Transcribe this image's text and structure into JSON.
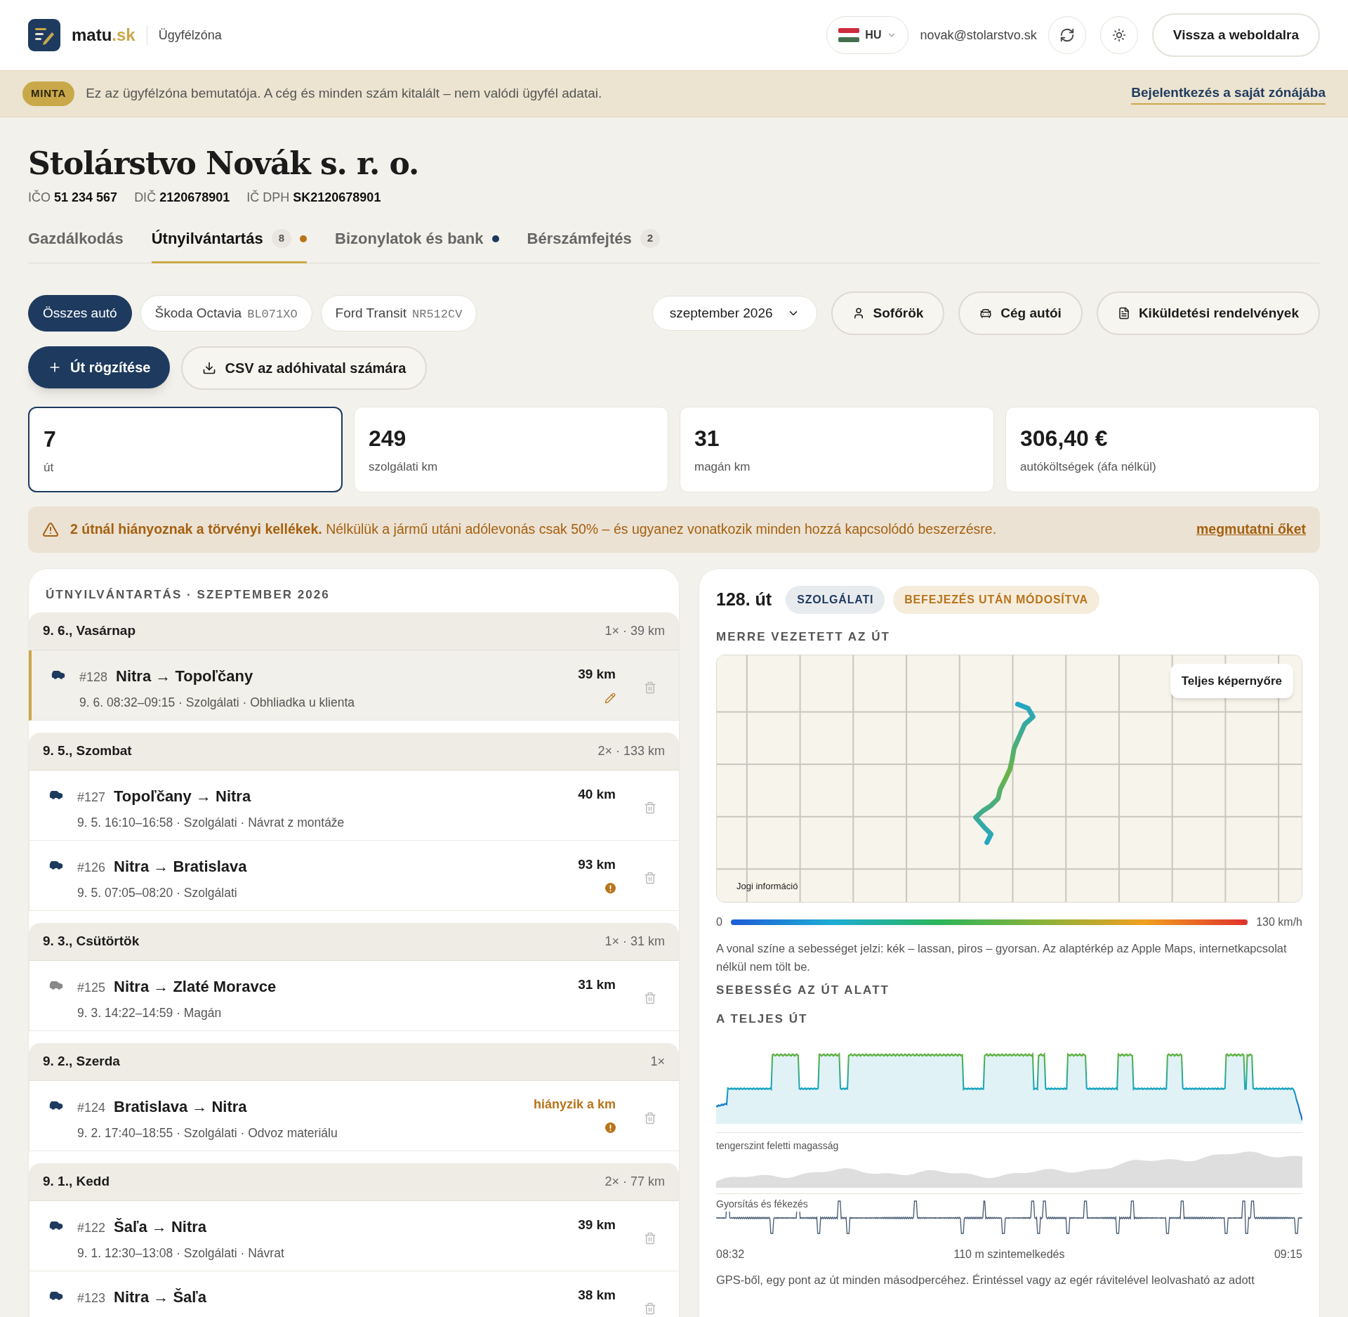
{
  "header": {
    "logo_text": "matu",
    "logo_suffix": ".sk",
    "section": "Ügyfélzóna",
    "language": "HU",
    "email": "novak@stolarstvo.sk",
    "back_button": "Vissza a weboldalra"
  },
  "banner": {
    "badge": "MINTA",
    "text": "Ez az ügyfélzóna bemutatója. A cég és minden szám kitalált – nem valódi ügyfél adatai.",
    "link": "Bejelentkezés a saját zónájába"
  },
  "company": {
    "name": "Stolárstvo Novák s. r. o.",
    "ids": [
      {
        "label": "IČO",
        "value": "51 234 567"
      },
      {
        "label": "DIČ",
        "value": "2120678901"
      },
      {
        "label": "IČ DPH",
        "value": "SK2120678901"
      }
    ]
  },
  "tabs": [
    {
      "label": "Gazdálkodás",
      "selected": false
    },
    {
      "label": "Útnyilvántartás",
      "selected": true,
      "count": "8",
      "color": "#b8741a"
    },
    {
      "label": "Bizonylatok és bank",
      "selected": false,
      "color": "#1e3a5f"
    },
    {
      "label": "Bérszámfejtés",
      "selected": false,
      "count": "2"
    }
  ],
  "car_filters": [
    {
      "label": "Összes autó",
      "selected": true
    },
    {
      "label": "Škoda Octavia",
      "plate": "BL071XO",
      "selected": false
    },
    {
      "label": "Ford Transit",
      "plate": "NR512CV",
      "selected": false
    }
  ],
  "month_select": {
    "value": "szeptember 2026"
  },
  "toolbar_buttons": [
    {
      "label": "Sofőrök"
    },
    {
      "label": "Cég autói"
    },
    {
      "label": "Kiküldetési rendelvények"
    }
  ],
  "actions": [
    {
      "label": "Út rögzítése",
      "kind": "primary"
    },
    {
      "label": "CSV az adóhivatal számára",
      "kind": "secondary"
    }
  ],
  "stats": [
    {
      "value": "7",
      "label": "út",
      "selected": true
    },
    {
      "value": "249",
      "label": "szolgálati km",
      "selected": false
    },
    {
      "value": "31",
      "label": "magán km",
      "selected": false
    },
    {
      "value": "306,40 €",
      "label": "autóköltségek (áfa nélkül)",
      "selected": false
    }
  ],
  "alert": {
    "text": "**2 útnál hiányoznak a törvényi kellékek.** Nélkülük a jármű utáni adólevonás csak 50% – és ugyanez vonatkozik minden hozzá kapcsolódó beszerzésre.",
    "link": "megmutatni őket"
  },
  "trip_log": {
    "title": "ÚTNYILVÁNTARTÁS · SZEPTEMBER 2026",
    "days": [
      {
        "date": "9. 6., Vasárnap",
        "summary": "1× · 39 km",
        "trips": [
          {
            "number": "#128",
            "route": "Nitra → Topoľčany",
            "details": "9. 6. 08:32–09:15 · Szolgálati · Obhliadka u klienta",
            "distance": "39 km",
            "selected": true,
            "private": false,
            "distance_missing": false,
            "kind": "edited"
          }
        ]
      },
      {
        "date": "9. 5., Szombat",
        "summary": "2× · 133 km",
        "trips": [
          {
            "number": "#127",
            "route": "Topoľčany → Nitra",
            "details": "9. 5. 16:10–16:58 · Szolgálati · Návrat z montáže",
            "distance": "40 km",
            "selected": false,
            "private": false,
            "distance_missing": false,
            "kind": "plain"
          },
          {
            "number": "#126",
            "route": "Nitra → Bratislava",
            "details": "9. 5. 07:05–08:20 · Szolgálati",
            "distance": "93 km",
            "selected": false,
            "private": false,
            "distance_missing": false,
            "kind": "warning"
          }
        ]
      },
      {
        "date": "9. 3., Csütörtök",
        "summary": "1× · 31 km",
        "trips": [
          {
            "number": "#125",
            "route": "Nitra → Zlaté Moravce",
            "details": "9. 3. 14:22–14:59 · Magán",
            "distance": "31 km",
            "selected": false,
            "private": true,
            "distance_missing": false,
            "kind": "plain"
          }
        ]
      },
      {
        "date": "9. 2., Szerda",
        "summary": "1×",
        "trips": [
          {
            "number": "#124",
            "route": "Bratislava → Nitra",
            "details": "9. 2. 17:40–18:55 · Szolgálati · Odvoz materiálu",
            "distance": "hiányzik a km",
            "selected": false,
            "private": false,
            "distance_missing": true,
            "kind": "warning"
          }
        ]
      },
      {
        "date": "9. 1., Kedd",
        "summary": "2× · 77 km",
        "trips": [
          {
            "number": "#122",
            "route": "Šaľa → Nitra",
            "details": "9. 1. 12:30–13:08 · Szolgálati · Návrat",
            "distance": "39 km",
            "selected": false,
            "private": false,
            "distance_missing": false,
            "kind": "plain"
          },
          {
            "number": "#123",
            "route": "Nitra → Šaľa",
            "distance": "38 km",
            "selected": false,
            "private": false,
            "distance_missing": false,
            "kind": "plain"
          }
        ]
      }
    ]
  },
  "detail": {
    "title": "128. út",
    "badges": [
      {
        "label": "SZOLGÁLATI",
        "kind": "category"
      },
      {
        "label": "BEFEJEZÉS UTÁN MÓDOSÍTVA",
        "kind": "warning"
      }
    ],
    "map_heading": "MERRE VEZETETT AZ ÚT",
    "fullscreen_button": "Teljes képernyőre",
    "legal_link": "Jogi információ",
    "speed_scale": {
      "min": "0",
      "max": "130 km/h"
    },
    "map_note": "A vonal színe a sebességet jelzi: kék – lassan, piros – gyorsan. Az alaptérkép az Apple Maps, internetkapcsolat nélkül nem tölt be.",
    "speed_heading": "SEBESSÉG AZ ÚT ALATT",
    "range_heading": "A TELJES ÚT",
    "elevation_label": "tengerszint feletti magasság",
    "accel_label": "Gyorsítás és fékezés",
    "time_start": "08:32",
    "climb": "110 m szintemelkedés",
    "time_end": "09:15",
    "footnote": "GPS-ből, egy pont az út minden másodpercéhez. Érintéssel vagy az egér rávitelével leolvasható az adott"
  }
}
